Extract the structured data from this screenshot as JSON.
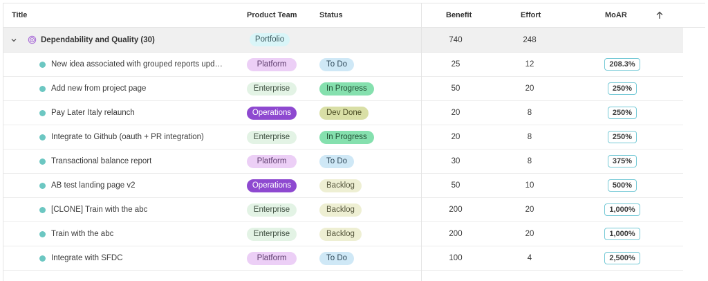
{
  "header": {
    "title": "Title",
    "product_team": "Product Team",
    "status": "Status",
    "benefit": "Benefit",
    "effort": "Effort",
    "moar": "MoAR"
  },
  "group": {
    "title": "Dependability and Quality (30)",
    "team": "Portfolio",
    "benefit": "740",
    "effort": "248"
  },
  "rows": [
    {
      "title": "New idea associated with grouped reports updated i...",
      "team": "Platform",
      "status": "To Do",
      "benefit": "25",
      "effort": "12",
      "moar": "208.3%"
    },
    {
      "title": "Add new from project page",
      "team": "Enterprise",
      "status": "In Progress",
      "benefit": "50",
      "effort": "20",
      "moar": "250%"
    },
    {
      "title": "Pay Later Italy relaunch",
      "team": "Operations",
      "status": "Dev Done",
      "benefit": "20",
      "effort": "8",
      "moar": "250%"
    },
    {
      "title": "Integrate to Github (oauth + PR integration)",
      "team": "Enterprise",
      "status": "In Progress",
      "benefit": "20",
      "effort": "8",
      "moar": "250%"
    },
    {
      "title": "Transactional balance report",
      "team": "Platform",
      "status": "To Do",
      "benefit": "30",
      "effort": "8",
      "moar": "375%"
    },
    {
      "title": "AB test landing page  v2",
      "team": "Operations",
      "status": "Backlog",
      "benefit": "50",
      "effort": "10",
      "moar": "500%"
    },
    {
      "title": "[CLONE] Train with the  abc",
      "team": "Enterprise",
      "status": "Backlog",
      "benefit": "200",
      "effort": "20",
      "moar": "1,000%"
    },
    {
      "title": "Train with the  abc",
      "team": "Enterprise",
      "status": "Backlog",
      "benefit": "200",
      "effort": "20",
      "moar": "1,000%"
    },
    {
      "title": "Integrate with SFDC",
      "team": "Platform",
      "status": "To Do",
      "benefit": "100",
      "effort": "4",
      "moar": "2,500%"
    }
  ],
  "colors": {
    "platform": "#eccff6",
    "enterprise": "#e3f3e5",
    "operations": "#8e49d0",
    "todo": "#cfe8f6",
    "in_progress": "#85e0ae",
    "dev_done": "#d9dfa6",
    "backlog": "#eeefd3",
    "dot": "#6cc7c2",
    "moar_border": "#75c9d6"
  },
  "icons": {
    "expand": "chevron-down-icon",
    "group": "spiral-icon",
    "sort": "arrow-up-icon",
    "row": "status-dot-icon"
  }
}
